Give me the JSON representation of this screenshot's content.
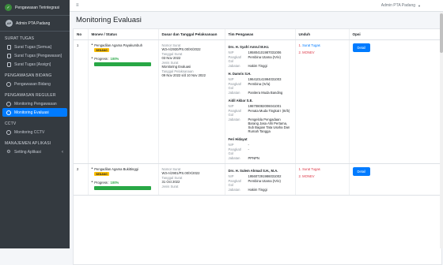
{
  "brand": {
    "logo": "✓",
    "name": "Pengawasan Terintegrasi"
  },
  "user": {
    "initials": "AP",
    "name": "Admin PTA Padang"
  },
  "sidebar": {
    "sections": [
      {
        "header": "SURAT TUGAS",
        "items": [
          "Surat Tugas [Semua]",
          "Surat Tugas [Pengawasan]",
          "Surat Tugas [Assign]"
        ]
      },
      {
        "header": "PENGAWASAN BIDANG",
        "items": [
          "Pengawasan Bidang"
        ]
      },
      {
        "header": "PENGAWASAN REGULER",
        "items": [
          "Monitoring Pengawasan",
          "Monitoring Evaluasi"
        ]
      },
      {
        "header": "CCTV",
        "items": [
          "Monitoring CCTV"
        ]
      },
      {
        "header": "MANAJEMEN APLIKASI",
        "items": [
          "Setting Aplikasi"
        ]
      }
    ]
  },
  "topbar": {
    "menu_icon": "≡",
    "user_name": "Admin PTA Padang",
    "caret": "▼"
  },
  "page": {
    "title": "Monitoring Evaluasi"
  },
  "table": {
    "headers": [
      "No",
      "Monev / Status",
      "Dasar dan Tanggal Pelaksanaan",
      "Tim Pengawas",
      "Unduh",
      "Opsi"
    ],
    "rows": [
      {
        "no": "1",
        "court": "Pengadilan Agama Payakumbuh",
        "status_badge": "SEDANG",
        "progress_label": "Progress :",
        "progress_value": "100%",
        "progress_fraction": 1.0,
        "nomor_label": "Nomor Surat",
        "nomor": "W3-A/2930/PS.00/XI/2022",
        "tanggal_label": "Tanggal Surat",
        "tanggal": "03 Nov 2022",
        "jenis_label": "Jenis Surat",
        "jenis": "Monitoring Evaluasi",
        "pelaksanaan_label": "Tanggal Pelaksanaan",
        "pelaksanaan": "09 Nov 2022 s/d 10 Nov 2022",
        "team": [
          {
            "name": "Drs. H. Syafri Amrul M.H.I.",
            "nip": "195804101987031006",
            "pangkat": "Pembina Utama (IV/e)",
            "jabatan": "Hakim Tinggi"
          },
          {
            "name": "H. Damris S.H.",
            "nip": "196410141994031003",
            "pangkat": "Pembina (IV/a)",
            "jabatan": "Panitera Muda Banding"
          },
          {
            "name": "Aidil Akbar S.E.",
            "nip": "198708082006041001",
            "pangkat": "Penata Muda Tingkat I (III/b)",
            "jabatan": "Pengelola Pengadaan Barang Jasa Ahli Pertama, Sub Bagian Tata Usaha Dan Rumah Tangga"
          },
          {
            "name": "Feri Hidayat",
            "nip": "-",
            "pangkat": "-",
            "jabatan": "PPNPN"
          }
        ],
        "downloads": [
          "Surat Tugas",
          "MONEV"
        ],
        "button": "Detail"
      },
      {
        "no": "2",
        "court": "Pengadilan Agama Bukittinggi",
        "status_badge": "SEDANG",
        "progress_label": "Progress :",
        "progress_value": "100%",
        "progress_fraction": 1.0,
        "nomor_label": "Nomor Surat",
        "nomor": "W3-A/2901/PS.00/X/2022",
        "tanggal_label": "Tanggal Surat",
        "tanggal": "31 Oct 2022",
        "jenis_label": "Jenis Surat",
        "team": [
          {
            "name": "Drs. H. Sulem Ahmad S.H., M.A.",
            "nip": "195607291986031002",
            "pangkat": "Pembina Utama (IV/e)",
            "jabatan": "Hakim Tinggi"
          }
        ],
        "downloads": [
          "Surat Tugas",
          "MONEV"
        ],
        "button": "Detail"
      }
    ],
    "field_labels": {
      "nip": "NIP",
      "pangkat": "Pangkat/ Gol",
      "jabatan": "Jabatan"
    }
  }
}
